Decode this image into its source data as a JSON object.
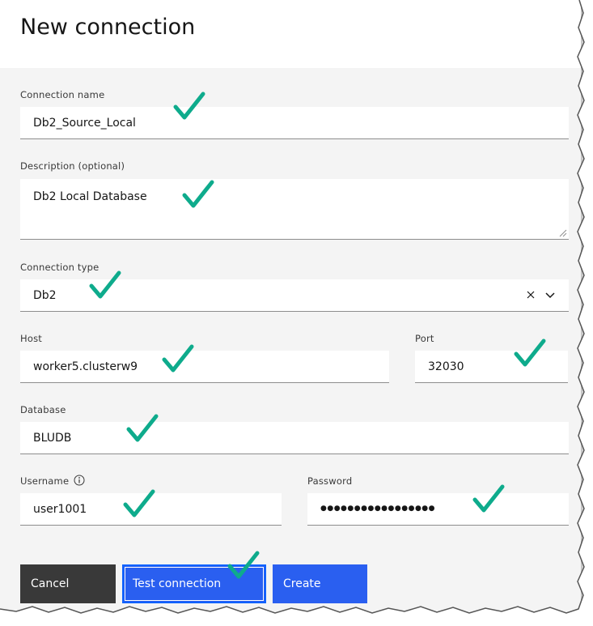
{
  "dialog": {
    "title": "New connection"
  },
  "form": {
    "connection_name": {
      "label": "Connection name",
      "value": "Db2_Source_Local"
    },
    "description": {
      "label": "Description (optional)",
      "value": "Db2 Local Database"
    },
    "connection_type": {
      "label": "Connection type",
      "value": "Db2"
    },
    "host": {
      "label": "Host",
      "value": "worker5.clusterw9"
    },
    "port": {
      "label": "Port",
      "value": "32030"
    },
    "database": {
      "label": "Database",
      "value": "BLUDB"
    },
    "username": {
      "label": "Username",
      "value": "user1001"
    },
    "password": {
      "label": "Password",
      "value": "●●●●●●●●●●●●●●●●●"
    }
  },
  "buttons": {
    "cancel": "Cancel",
    "test_connection": "Test connection",
    "create": "Create"
  },
  "colors": {
    "checkmark": "#0eab8c",
    "primary": "#2a5ff0",
    "secondary": "#393939"
  },
  "icons": [
    "clear-icon",
    "chevron-down-icon",
    "info-icon",
    "resize-handle-icon",
    "checkmark-icon"
  ]
}
